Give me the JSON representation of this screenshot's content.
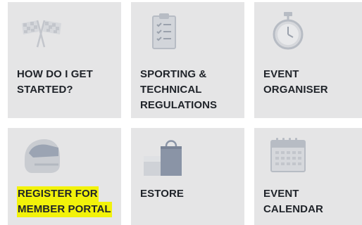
{
  "tiles": [
    {
      "id": "how-do-i-get-started",
      "icon": "racing-flags-icon",
      "lines": [
        "HOW DO I GET",
        "STARTED?"
      ],
      "highlighted": false
    },
    {
      "id": "sporting-technical-regulations",
      "icon": "clipboard-checklist-icon",
      "lines": [
        "SPORTING &",
        "TECHNICAL",
        "REGULATIONS"
      ],
      "highlighted": false
    },
    {
      "id": "event-organiser",
      "icon": "stopwatch-icon",
      "lines": [
        "EVENT",
        "ORGANISER"
      ],
      "highlighted": false
    },
    {
      "id": "register-member-portal",
      "icon": "helmet-icon",
      "lines": [
        "REGISTER FOR",
        "MEMBER PORTAL"
      ],
      "highlighted": true
    },
    {
      "id": "estore",
      "icon": "shopping-bag-icon",
      "lines": [
        "ESTORE"
      ],
      "highlighted": false
    },
    {
      "id": "event-calendar",
      "icon": "calendar-icon",
      "lines": [
        "EVENT",
        "CALENDAR"
      ],
      "highlighted": false
    }
  ],
  "colors": {
    "tile_bg": "#e5e5e6",
    "text": "#1f2329",
    "highlight": "#f2f20a",
    "icon_light": "#c3c6cc",
    "icon_dark": "#8a94a6"
  }
}
